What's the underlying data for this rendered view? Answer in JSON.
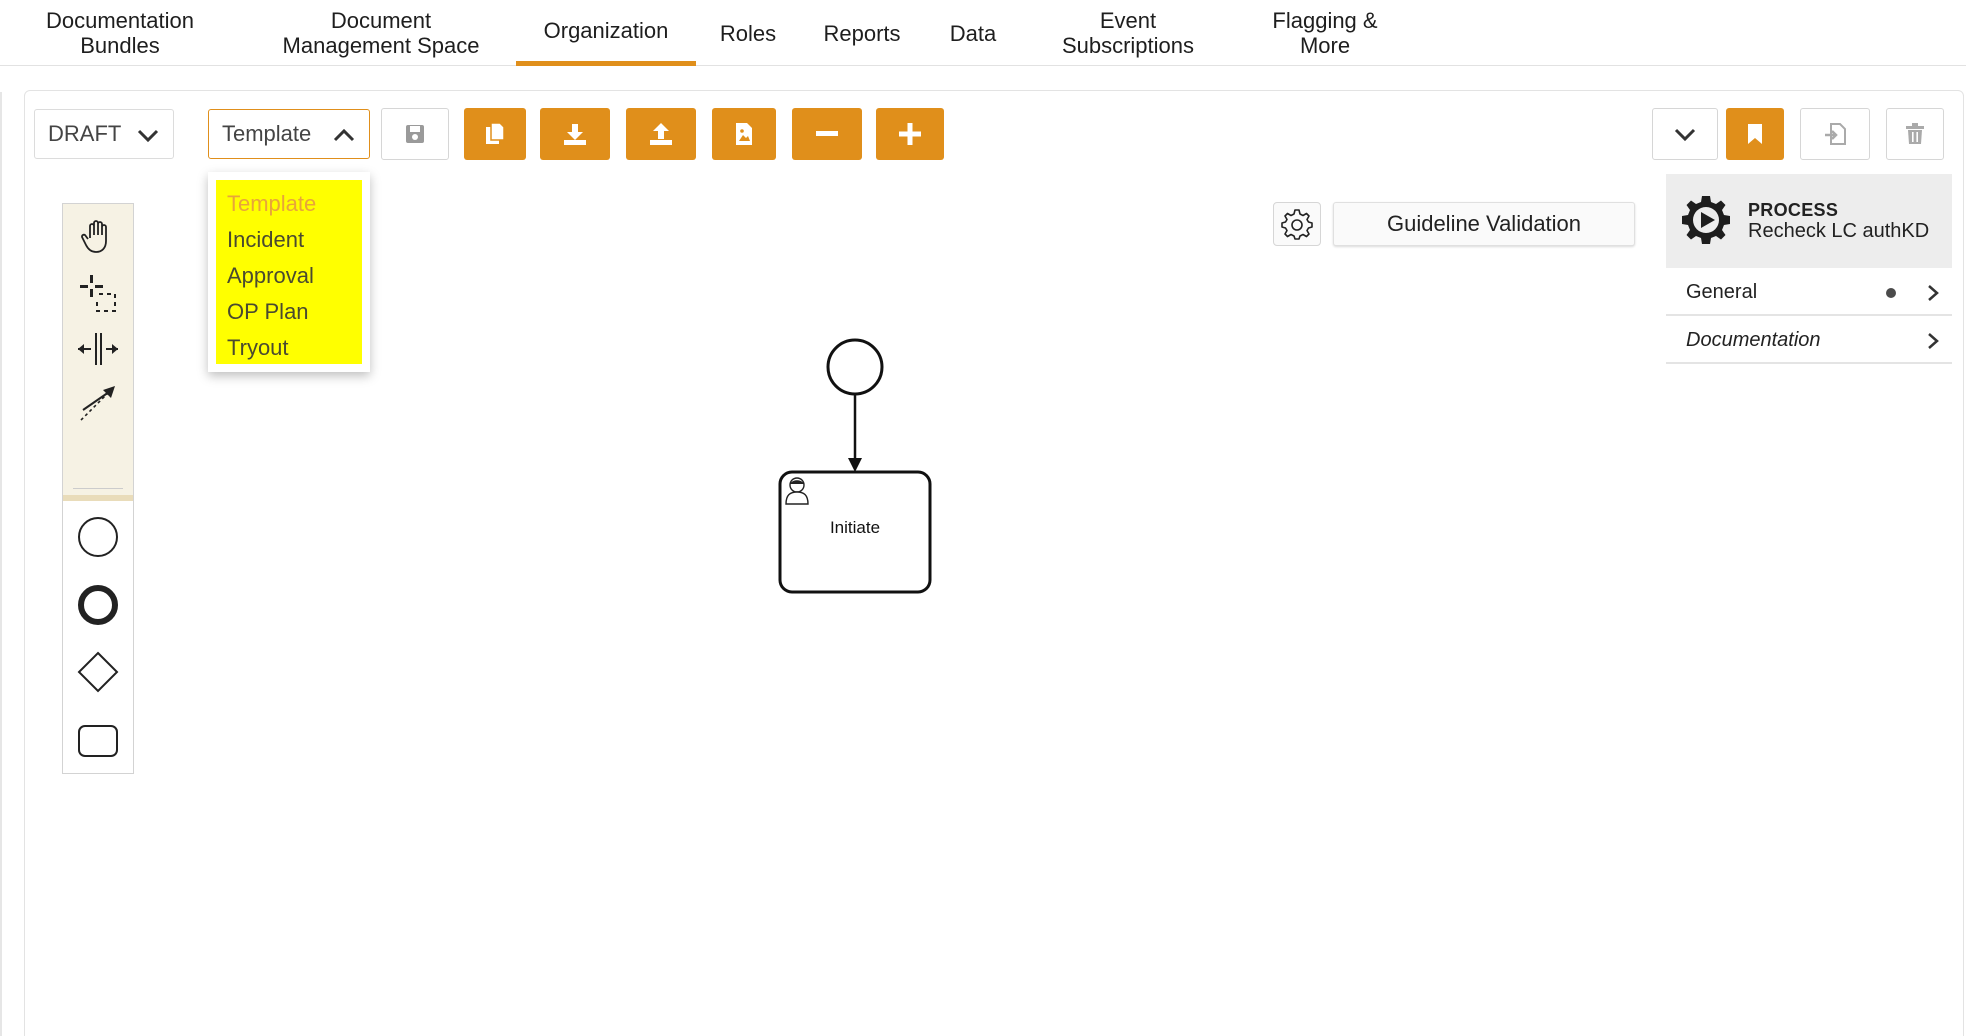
{
  "nav": {
    "tabs": [
      {
        "label": "Documentation\nBundles",
        "active": false
      },
      {
        "label": "Document\nManagement Space",
        "active": false
      },
      {
        "label": "Organization",
        "active": true
      },
      {
        "label": "Roles",
        "active": false
      },
      {
        "label": "Reports",
        "active": false
      },
      {
        "label": "Data",
        "active": false
      },
      {
        "label": "Event\nSubscriptions",
        "active": false
      },
      {
        "label": "Flagging &\nMore",
        "active": false
      }
    ]
  },
  "toolbar": {
    "status_select": {
      "value": "DRAFT"
    },
    "type_select": {
      "value": "Template",
      "open": true
    },
    "buttons": [
      "save-icon",
      "copy-icon",
      "download-icon",
      "upload-icon",
      "image-export-icon",
      "zoom-out-icon",
      "zoom-in-icon"
    ],
    "right_buttons": [
      "chevron-down-icon",
      "bookmark-icon",
      "import-icon",
      "trash-icon"
    ]
  },
  "dropdown": {
    "options": [
      "Template",
      "Incident",
      "Approval",
      "OP Plan",
      "Tryout"
    ],
    "selected": "Template"
  },
  "palette": {
    "tools": [
      "hand-tool-icon",
      "lasso-tool-icon",
      "space-tool-icon",
      "connect-tool-icon"
    ],
    "shapes": [
      "start-event-icon",
      "end-event-icon",
      "gateway-icon",
      "task-icon"
    ]
  },
  "validation": {
    "label": "Guideline Validation"
  },
  "properties": {
    "type": "PROCESS",
    "name": "Recheck LC authKD",
    "sections": [
      {
        "label": "General",
        "has_dot": true
      },
      {
        "label": "Documentation",
        "has_dot": false
      }
    ]
  },
  "diagram": {
    "task_label": "Initiate"
  },
  "colors": {
    "accent": "#e08f1b",
    "dropdown_highlight": "#ffff00",
    "palette_bg": "#f6f2e4"
  }
}
